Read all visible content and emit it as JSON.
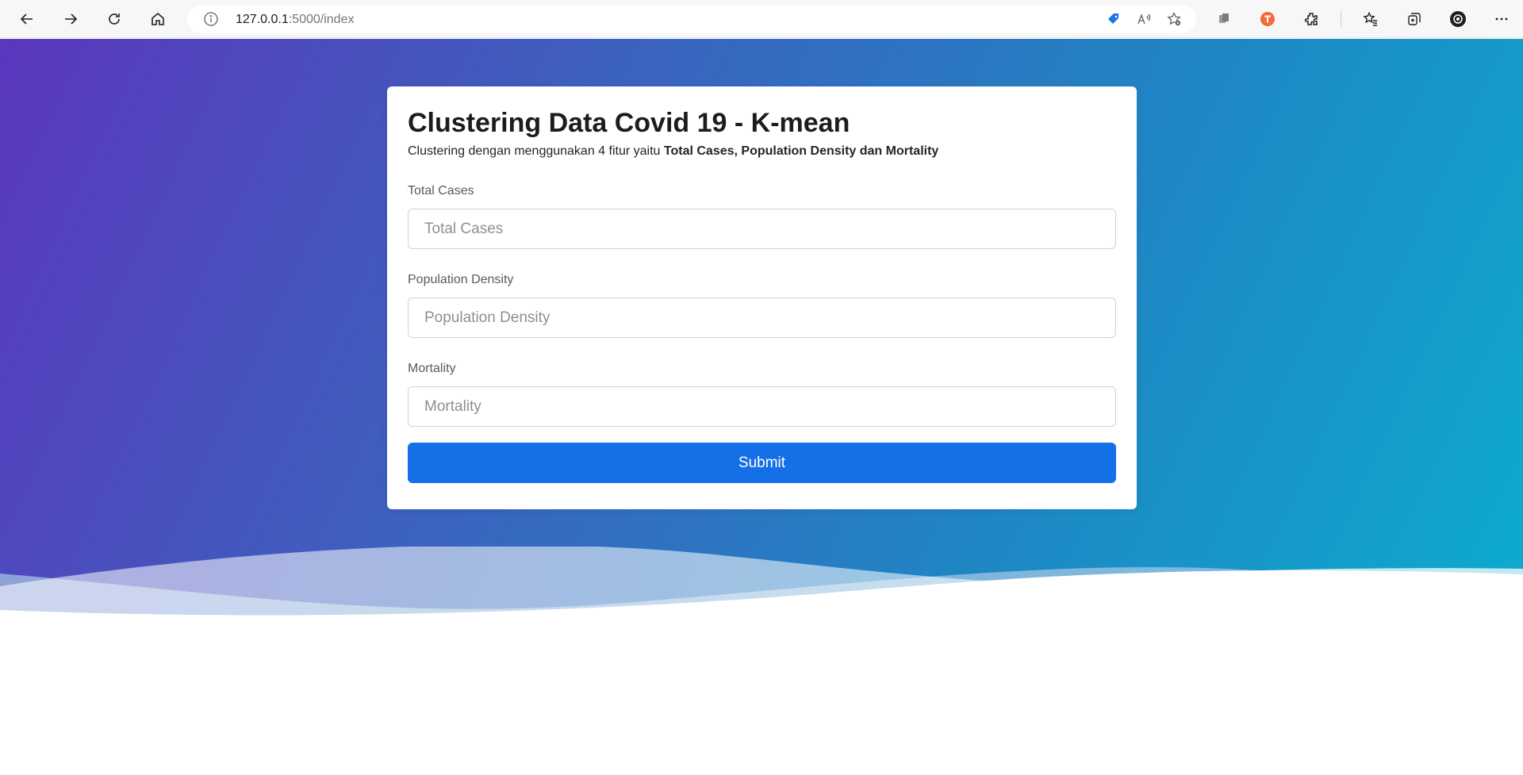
{
  "browser": {
    "url_host": "127.0.0.1",
    "url_path": ":5000/index",
    "nav": {
      "back": "back-icon",
      "forward": "forward-icon",
      "refresh": "refresh-icon",
      "home": "home-icon"
    },
    "address_icons": [
      "site-info-icon",
      "price-tag-icon",
      "read-aloud-icon",
      "add-favorite-icon"
    ],
    "toolbar_icons": [
      "extension-icon",
      "profile-extension-icon",
      "extensions-icon",
      "favorites-icon",
      "collections-icon",
      "account-icon",
      "more-icon"
    ],
    "colors": {
      "price_tag": "#1a73e8",
      "ext_orange": "#f26b3a"
    }
  },
  "form": {
    "title": "Clustering Data Covid 19 - K-mean",
    "subtitle_prefix": "Clustering dengan menggunakan 4 fitur yaitu",
    "subtitle_bold": "Total Cases, Population Density dan Mortality",
    "fields": [
      {
        "label": "Total Cases",
        "placeholder": "Total Cases",
        "value": ""
      },
      {
        "label": "Population Density",
        "placeholder": "Population Density",
        "value": ""
      },
      {
        "label": "Mortality",
        "placeholder": "Mortality",
        "value": ""
      }
    ],
    "submit_label": "Submit"
  },
  "theme": {
    "gradient_start": "#5b37bd",
    "gradient_end": "#0bb0cf",
    "primary": "#1570e8"
  }
}
